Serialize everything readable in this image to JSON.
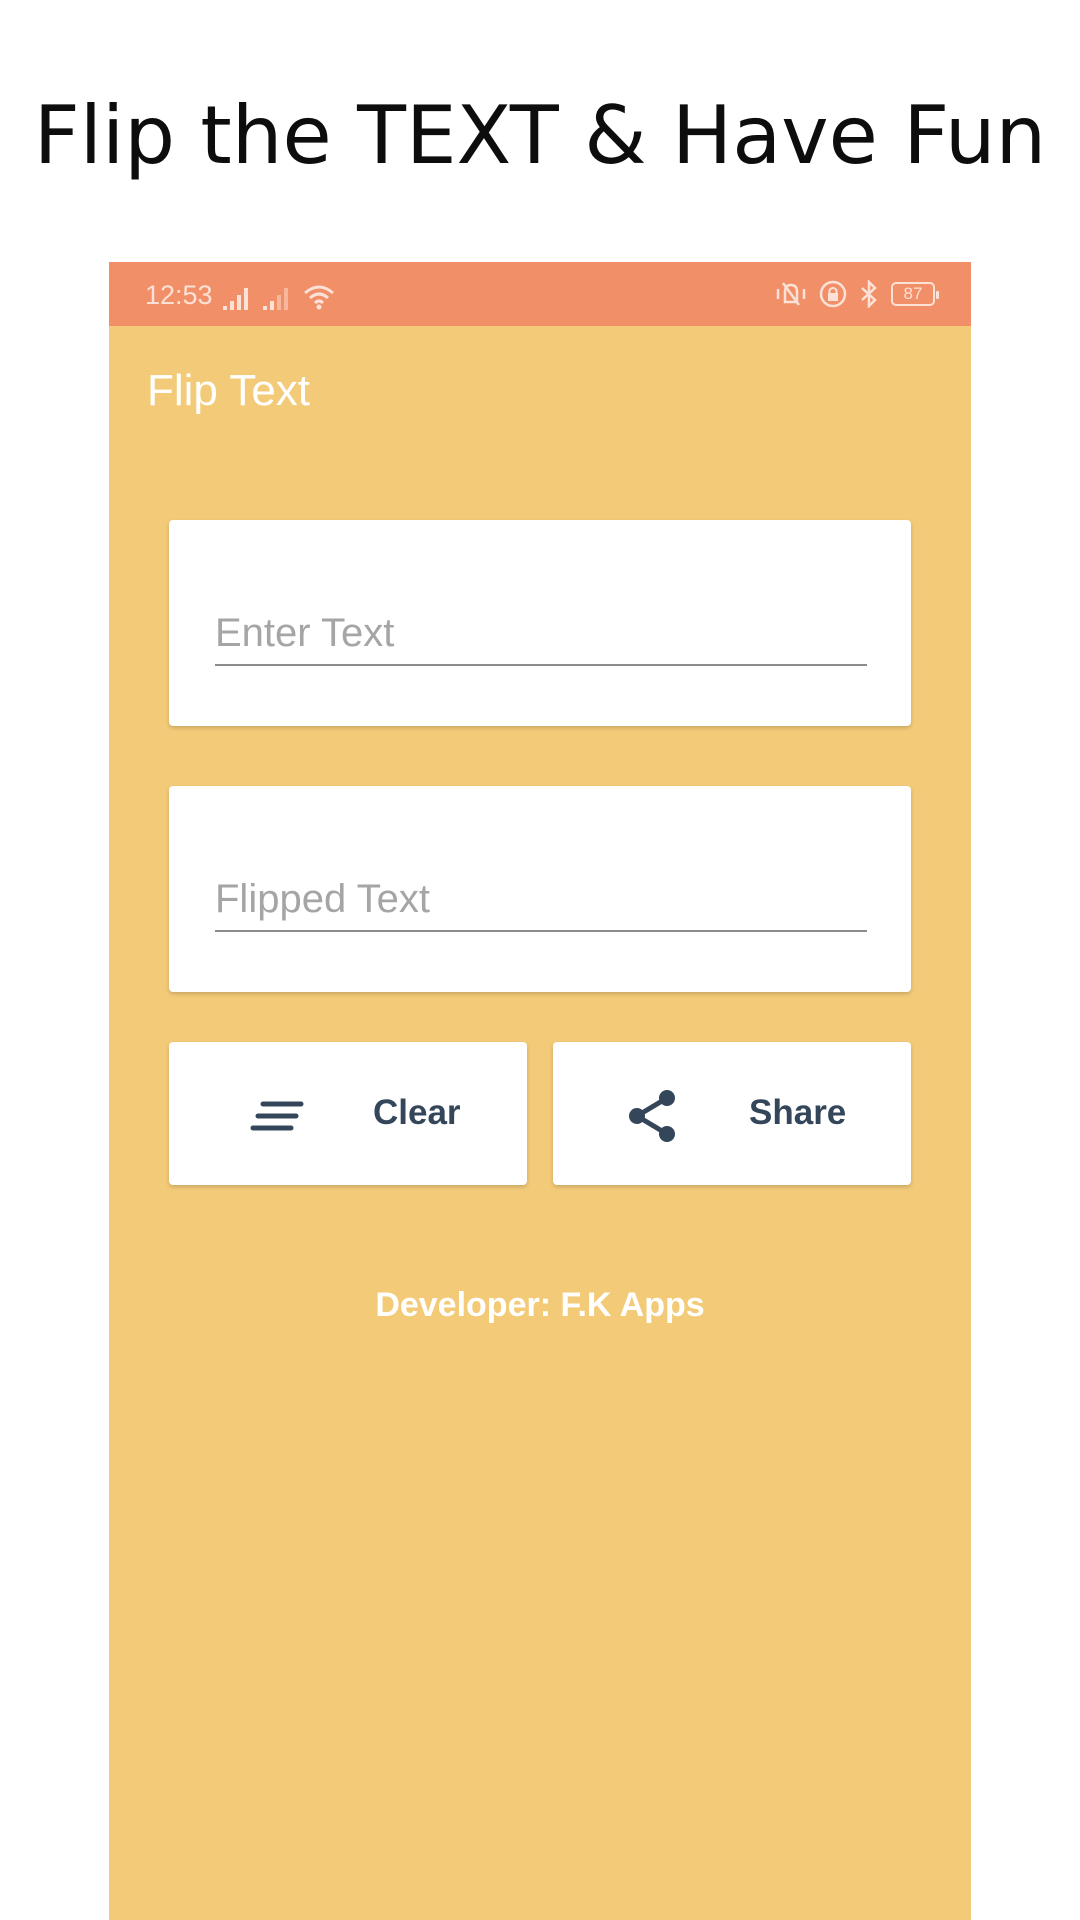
{
  "promo": {
    "title": "Flip the TEXT & Have Fun"
  },
  "status_bar": {
    "time": "12:53",
    "battery_level": "87",
    "icons": [
      "signal-icon",
      "signal-icon",
      "wifi-icon",
      "vibrate-icon",
      "lock-icon",
      "bluetooth-icon",
      "battery-icon"
    ]
  },
  "app_bar": {
    "title": "Flip Text"
  },
  "input": {
    "value": "",
    "placeholder": "Enter Text"
  },
  "output": {
    "value": "",
    "placeholder": "Flipped Text"
  },
  "buttons": {
    "clear_label": "Clear",
    "clear_icon": "clear-lines-icon",
    "share_label": "Share",
    "share_icon": "share-icon"
  },
  "footer": {
    "developer": "Developer: F.K Apps"
  },
  "colors": {
    "background": "#f3cb78",
    "status_bar": "#f18f68",
    "button_text": "#34465a"
  }
}
